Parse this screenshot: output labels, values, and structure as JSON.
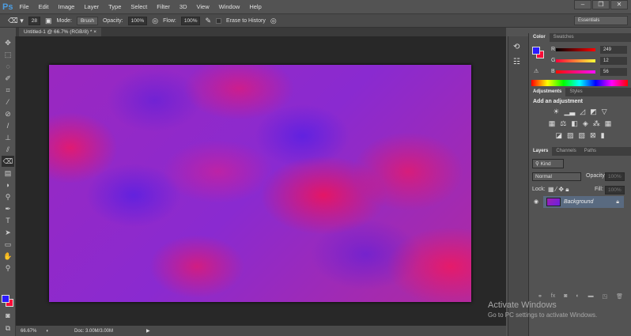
{
  "app": {
    "logo": "Ps"
  },
  "menu": [
    "File",
    "Edit",
    "Image",
    "Layer",
    "Type",
    "Select",
    "Filter",
    "3D",
    "View",
    "Window",
    "Help"
  ],
  "window_controls": {
    "minimize": "–",
    "restore": "❐",
    "close": "✕"
  },
  "options": {
    "brush_size": "28",
    "mode_label": "Mode:",
    "mode_value": "Brush",
    "opacity_label": "Opacity:",
    "opacity_value": "100%",
    "flow_label": "Flow:",
    "flow_value": "100%",
    "erase_to_history": "Erase to History"
  },
  "workspace": "Essentials",
  "document_tab": {
    "title": "Untitled-1 @ 66.7% (RGB/8) *",
    "close": "×"
  },
  "status": {
    "zoom": "66.67%",
    "doc": "Doc: 3.00M/3.00M"
  },
  "color_panel": {
    "tabs": [
      "Color",
      "Swatches"
    ],
    "r_label": "R",
    "g_label": "G",
    "b_label": "B",
    "r": "249",
    "g": "12",
    "b": "56",
    "fg": "#2a1aff",
    "bg": "#f90c38"
  },
  "adjustments_panel": {
    "tabs": [
      "Adjustments",
      "Styles"
    ],
    "heading": "Add an adjustment"
  },
  "layers_panel": {
    "tabs": [
      "Layers",
      "Channels",
      "Paths"
    ],
    "filter": "Kind",
    "blend_mode": "Normal",
    "opacity_label": "Opacity:",
    "opacity_value": "100%",
    "lock_label": "Lock:",
    "fill_label": "Fill:",
    "fill_value": "100%",
    "layers": [
      {
        "name": "Background"
      }
    ]
  },
  "watermark": {
    "title": "Activate Windows",
    "subtitle": "Go to PC settings to activate Windows."
  }
}
